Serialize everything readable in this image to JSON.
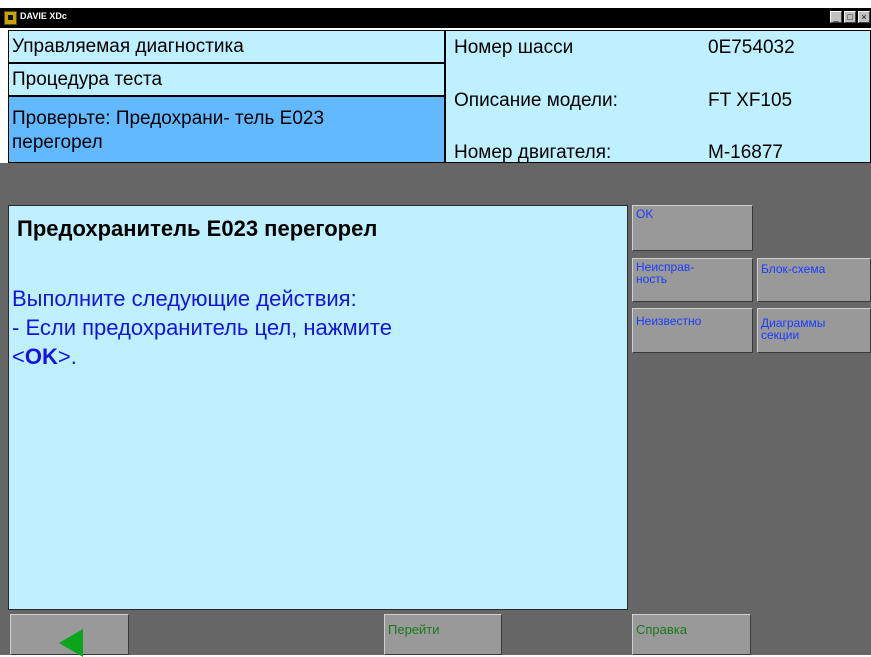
{
  "window": {
    "title": "DAVIE XDc",
    "icon": "app-truck-icon",
    "controls": [
      "minimize-icon",
      "maximize-icon",
      "close-icon"
    ]
  },
  "header": {
    "left": {
      "title": "Управляемая диагностика",
      "subtitle": "Процедура теста",
      "active_line1": "Проверьте: Предохрани- тель E023",
      "active_line2": "перегорел"
    },
    "vehicle": {
      "chassis_label": "Номер шасси",
      "chassis_value": "0E754032",
      "model_label": "Описание модели:",
      "model_value": "FT XF105",
      "engine_label": "Номер двигателя:",
      "engine_value": "M-16877"
    }
  },
  "message": {
    "heading": "Предохранитель E023 перегорел",
    "line1": "Выполните следующие действия:",
    "line2": "- Если предохранитель цел, нажмите",
    "line3_open": "<",
    "line3_ok": "OK",
    "line3_close": ">."
  },
  "side_buttons": {
    "ok": "OK",
    "fault": "Неисправ-\nность",
    "block_diagram": "Блок-схема",
    "unknown": "Неизвестно",
    "section_diagrams": "Диаграммы\nсекции"
  },
  "bottom_bar": {
    "back_icon": "back-arrow-icon",
    "goto": "Перейти",
    "help": "Справка"
  },
  "colors": {
    "panel_bg": "#bff0ff",
    "active_bg": "#63b9ff",
    "workspace_bg": "#666666",
    "button_bg": "#999999",
    "message_text": "#1414e0",
    "bottom_text": "#1a7a1a",
    "arrow": "#0aa51a"
  }
}
